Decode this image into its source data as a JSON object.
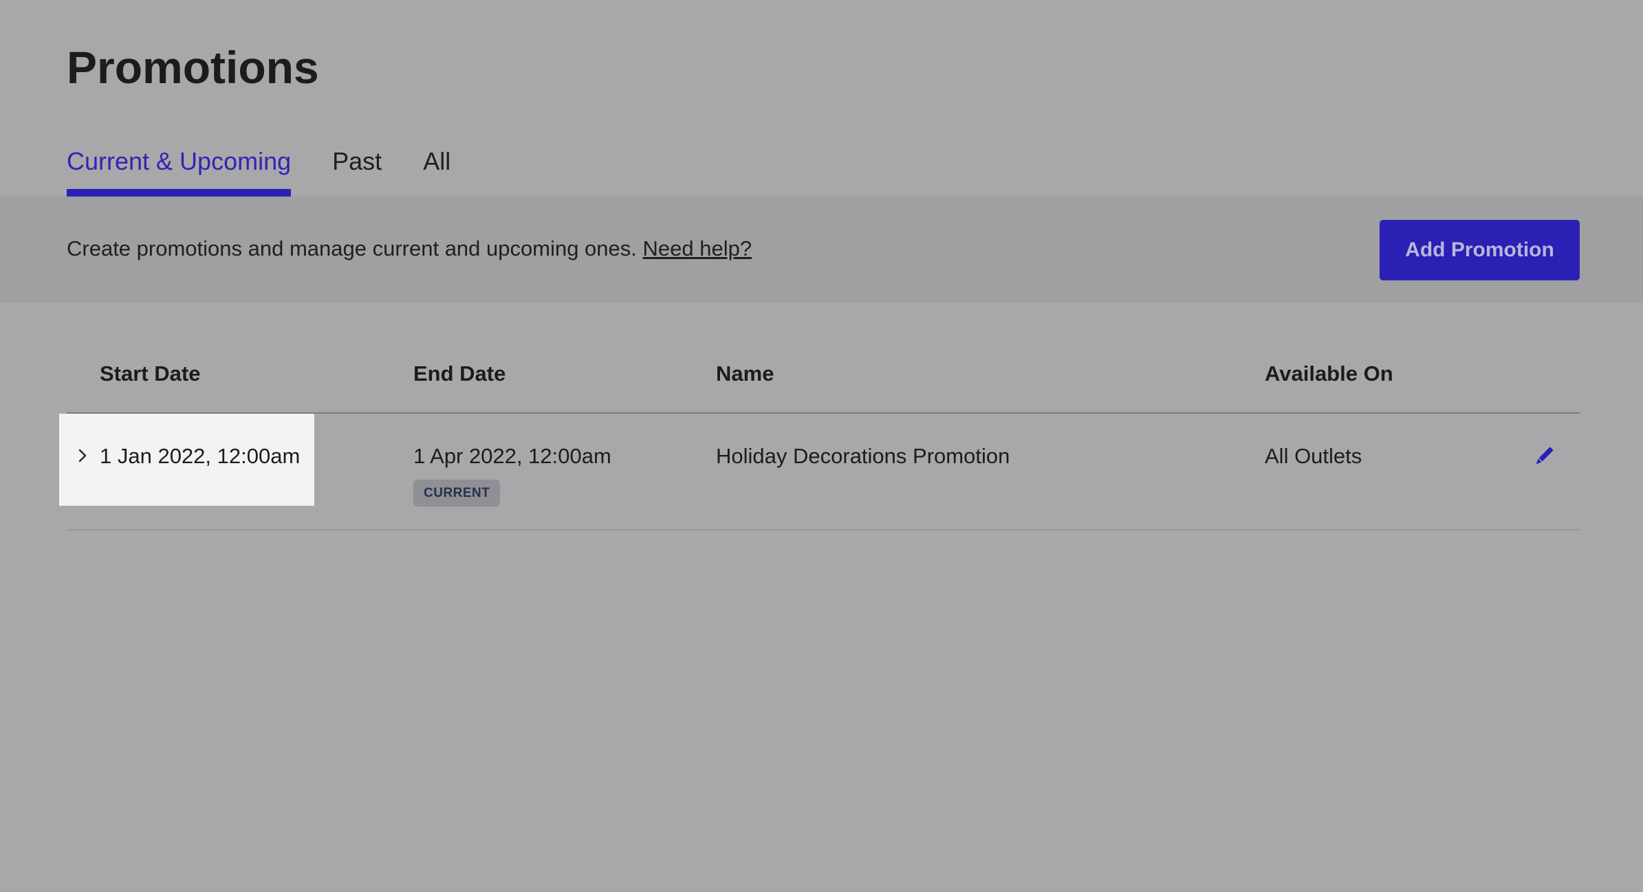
{
  "page": {
    "title": "Promotions"
  },
  "tabs": [
    {
      "label": "Current & Upcoming",
      "active": true
    },
    {
      "label": "Past",
      "active": false
    },
    {
      "label": "All",
      "active": false
    }
  ],
  "banner": {
    "description": "Create promotions and manage current and upcoming ones.",
    "help_link": "Need help?",
    "add_button": "Add Promotion"
  },
  "table": {
    "columns": [
      "Start Date",
      "End Date",
      "Name",
      "Available On"
    ],
    "rows": [
      {
        "start_date": "1 Jan 2022, 12:00am",
        "end_date": "1 Apr 2022, 12:00am",
        "status": "CURRENT",
        "name": "Holiday Decorations Promotion",
        "available_on": "All Outlets"
      }
    ]
  },
  "icons": {
    "expand": "chevron-right-icon",
    "edit": "pencil-icon"
  },
  "colors": {
    "accent": "#2a1fb8",
    "background": "#a8a8aa",
    "banner": "#a09fa2",
    "badge": "#8f8f94"
  }
}
